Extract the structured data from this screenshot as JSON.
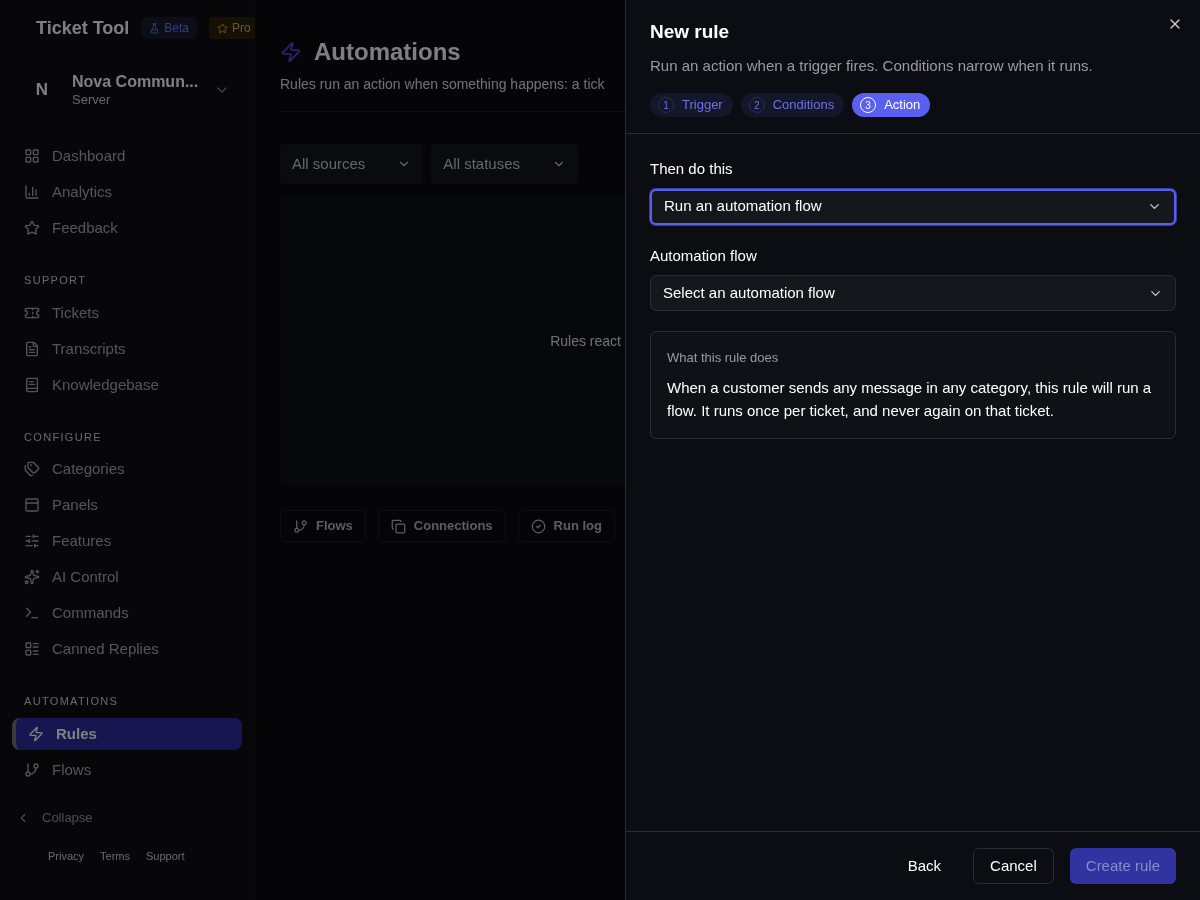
{
  "app": {
    "name": "Ticket Tool",
    "badges": [
      {
        "label": "Beta",
        "kind": "beta"
      },
      {
        "label": "Pro",
        "kind": "pro"
      }
    ]
  },
  "server": {
    "initial": "N",
    "name": "Nova Commun...",
    "subtitle": "Server"
  },
  "sidebar": {
    "sections": [
      {
        "items": [
          {
            "label": "Dashboard",
            "selected": false
          },
          {
            "label": "Analytics",
            "selected": false
          },
          {
            "label": "Feedback",
            "selected": false
          }
        ]
      },
      {
        "heading": "SUPPORT",
        "items": [
          {
            "label": "Tickets",
            "selected": false
          },
          {
            "label": "Transcripts",
            "selected": false
          },
          {
            "label": "Knowledgebase",
            "selected": false
          }
        ]
      },
      {
        "heading": "CONFIGURE",
        "items": [
          {
            "label": "Categories",
            "selected": false
          },
          {
            "label": "Panels",
            "selected": false
          },
          {
            "label": "Features",
            "selected": false
          },
          {
            "label": "AI Control",
            "selected": false
          },
          {
            "label": "Commands",
            "selected": false
          },
          {
            "label": "Canned Replies",
            "selected": false
          }
        ]
      },
      {
        "heading": "AUTOMATIONS",
        "items": [
          {
            "label": "Rules",
            "selected": true
          },
          {
            "label": "Flows",
            "selected": false
          }
        ]
      }
    ],
    "collapse": "Collapse",
    "footer_links": [
      "Privacy",
      "Terms",
      "Support"
    ]
  },
  "page": {
    "title": "Automations",
    "subtitle": "Rules run an action when something happens: a tick",
    "filters": [
      "All sources",
      "All statuses"
    ],
    "empty_text": "Rules react",
    "tabs": [
      "Flows",
      "Connections",
      "Run log"
    ]
  },
  "drawer": {
    "title": "New rule",
    "description": "Run an action when a trigger fires. Conditions narrow when it runs.",
    "steps": [
      {
        "number": "1",
        "label": "Trigger",
        "selected": false
      },
      {
        "number": "2",
        "label": "Conditions",
        "selected": false
      },
      {
        "number": "3",
        "label": "Action",
        "selected": true
      }
    ],
    "fields": [
      {
        "label": "Then do this",
        "value": "Run an automation flow",
        "focused": true
      },
      {
        "label": "Automation flow",
        "value": "Select an automation flow",
        "focused": false
      }
    ],
    "summary": {
      "heading": "What this rule does",
      "text": "When a customer sends any message in any category, this rule will run a flow. It runs once per ticket, and never again on that ticket."
    },
    "buttons": [
      {
        "label": "Back",
        "kind": "ghost",
        "disabled": false
      },
      {
        "label": "Cancel",
        "kind": "outline",
        "disabled": false
      },
      {
        "label": "Create rule",
        "kind": "primary",
        "disabled": true
      }
    ]
  }
}
